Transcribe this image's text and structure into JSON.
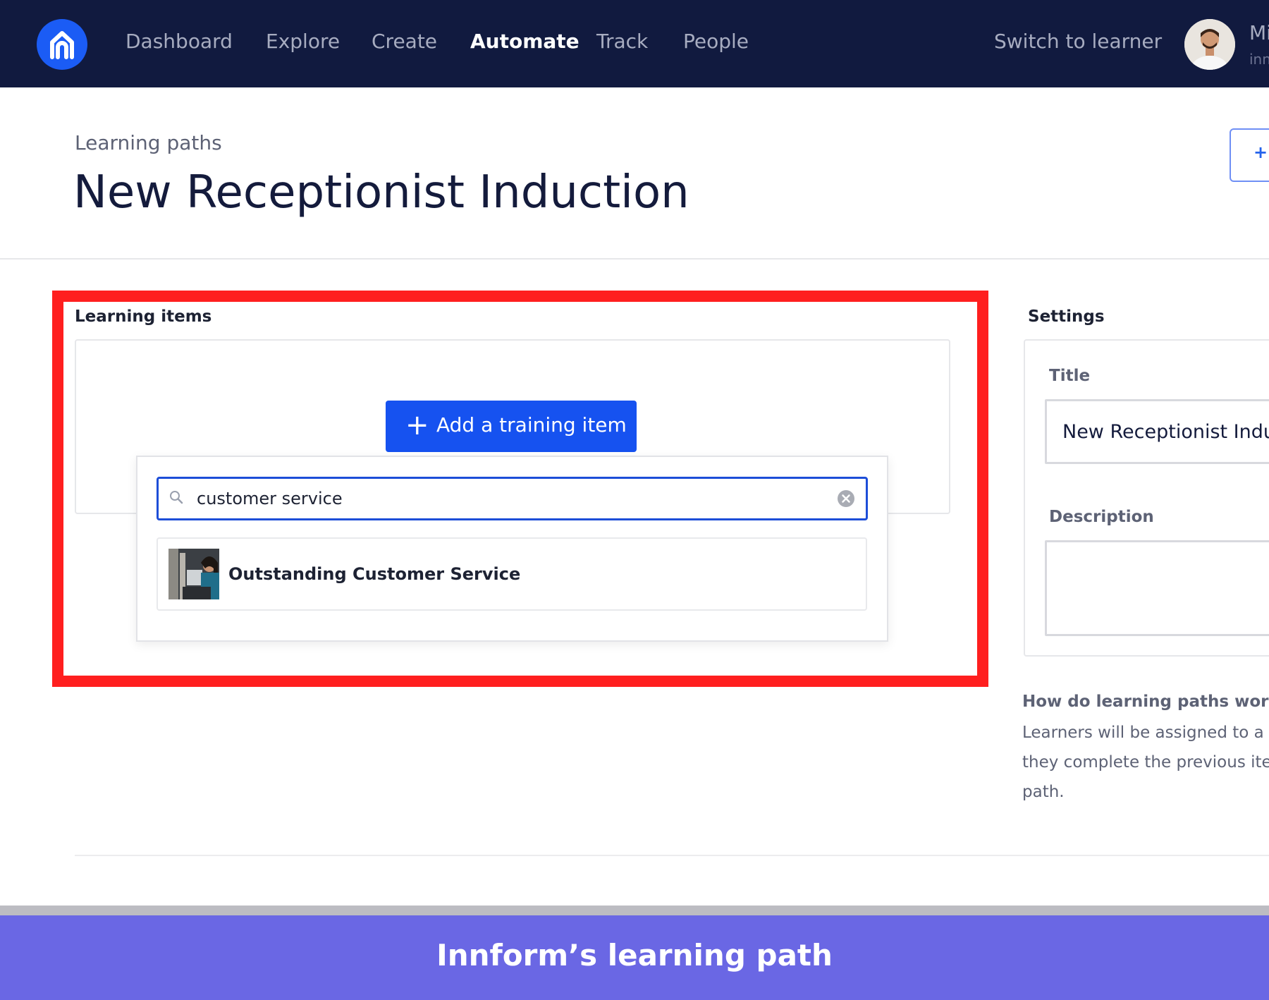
{
  "nav": {
    "logo_icon": "home-icon",
    "items": [
      {
        "label": "Dashboard"
      },
      {
        "label": "Explore"
      },
      {
        "label": "Create"
      },
      {
        "label": "Automate",
        "active": true
      },
      {
        "label": "Track"
      },
      {
        "label": "People"
      }
    ],
    "switch_label": "Switch to learner",
    "user_name": "Mi",
    "user_sub": "inn"
  },
  "header": {
    "breadcrumb": "Learning paths",
    "title": "New Receptionist Induction",
    "action_label": "+ "
  },
  "learning_items": {
    "label": "Learning items",
    "add_button": {
      "icon": "+",
      "label": "Add a training item"
    },
    "search": {
      "value": "customer service",
      "placeholder": ""
    },
    "results": [
      {
        "title": "Outstanding Customer Service",
        "thumbnail": "course-thumbnail-image"
      }
    ]
  },
  "settings": {
    "label": "Settings",
    "title_label": "Title",
    "title_value": "New Receptionist Induc",
    "description_label": "Description",
    "description_value": ""
  },
  "help": {
    "title": "How do learning paths work?",
    "lines": [
      "Learners will be assigned to a t",
      "they complete the previous item",
      "path."
    ]
  },
  "caption": "Innform’s learning path",
  "colors": {
    "navbar": "#111a3f",
    "primary": "#1652f0",
    "highlight": "#ff1f1f",
    "caption_bar": "#6a67e4"
  }
}
